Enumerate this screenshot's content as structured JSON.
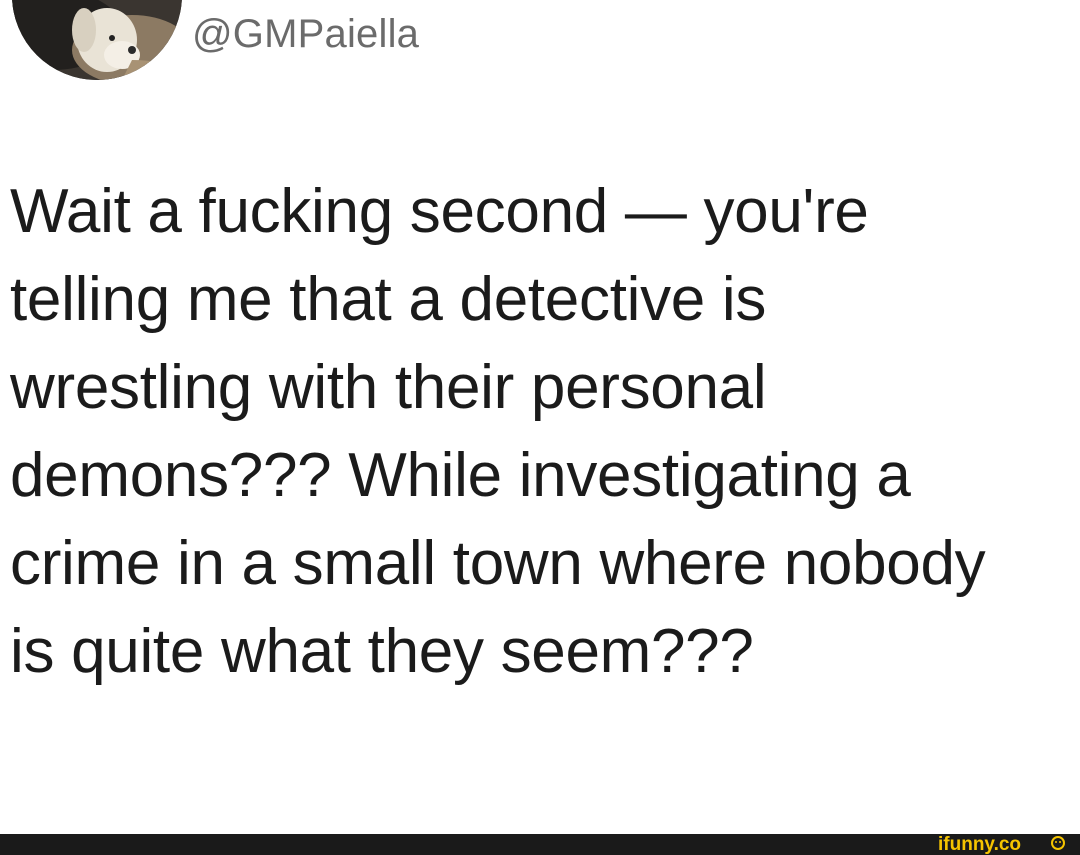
{
  "tweet": {
    "handle": "@GMPaiella",
    "lines": [
      "Wait a fucking second — you're",
      "telling me that a detective is",
      "wrestling with their personal",
      "demons??? While investigating a",
      "crime in a small town where nobody",
      "is quite what they seem???"
    ]
  },
  "avatar": {
    "icon": "dog-photo-avatar"
  },
  "footer": {
    "watermark_text": "ifunny.co",
    "colors": {
      "bar": "#1a1a1a",
      "watermark": "#f5c400"
    }
  }
}
